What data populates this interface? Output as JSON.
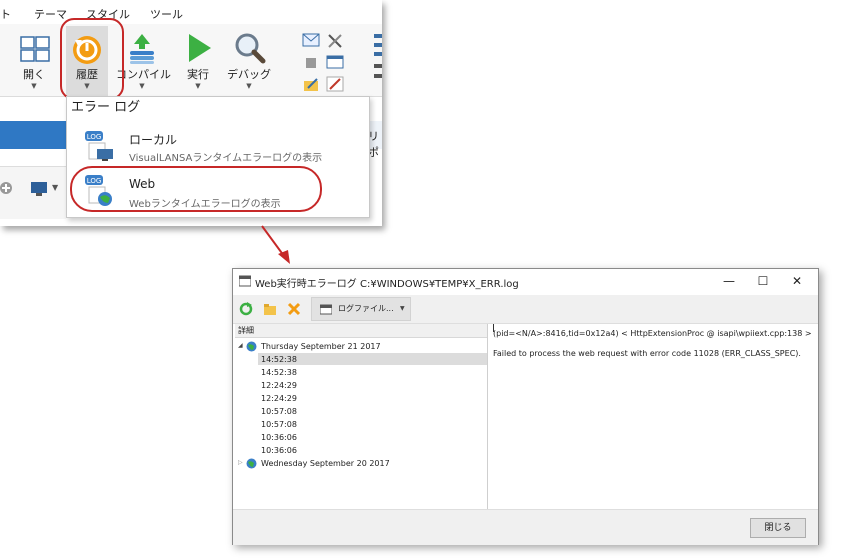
{
  "ribbon": {
    "tabs": [
      "ト",
      "テーマ",
      "スタイル",
      "ツール"
    ],
    "buttons": {
      "open": "開く",
      "history": "履歴",
      "compile": "コンパイル",
      "run": "実行",
      "debug": "デバッグ"
    },
    "side_label": "リポ"
  },
  "dropdown": {
    "header": "エラー ログ",
    "items": [
      {
        "title": "ローカル",
        "subtitle": "VisualLANSAランタイムエラーログの表示"
      },
      {
        "title": "Web",
        "subtitle": "Webランタイムエラーログの表示"
      }
    ]
  },
  "dialog": {
    "title": "Web実行時エラーログ C:¥WINDOWS¥TEMP¥X_ERR.log",
    "window_buttons": {
      "minimize": "—",
      "maximize": "☐",
      "close": "✕"
    },
    "toolbar": {
      "logfile_label": "ログファイル..."
    },
    "left_header": "詳細",
    "tree": [
      {
        "label": "Thursday September 21 2017",
        "expanded": true,
        "times": [
          "14:52:38",
          "14:52:38",
          "12:24:29",
          "12:24:29",
          "10:57:08",
          "10:57:08",
          "10:36:06",
          "10:36:06"
        ],
        "selected_index": 0
      },
      {
        "label": "Wednesday September 20 2017",
        "expanded": false,
        "times": []
      }
    ],
    "detail": {
      "line1": "(pid=<N/A>:8416,tid=0x12a4) < HttpExtensionProc @ isapi\\wpiiext.cpp:138 >",
      "line2": "Failed to process the web request with error code 11028 (ERR_CLASS_SPEC)."
    },
    "close_label": "閉じる"
  },
  "colors": {
    "highlight_ring": "#c62828",
    "ribbon_blue": "#2f78c4",
    "accent_green": "#3cb043",
    "accent_orange": "#f39c12"
  }
}
